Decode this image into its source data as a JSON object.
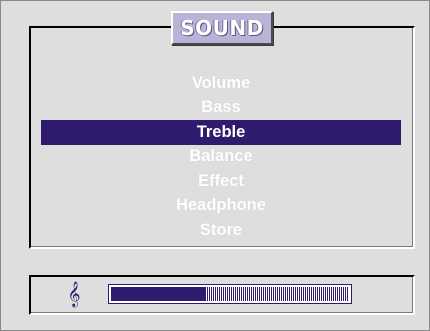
{
  "title": "SOUND",
  "menu": {
    "items": [
      {
        "label": "Volume",
        "selected": false
      },
      {
        "label": "Bass",
        "selected": false
      },
      {
        "label": "Treble",
        "selected": true
      },
      {
        "label": "Balance",
        "selected": false
      },
      {
        "label": "Effect",
        "selected": false
      },
      {
        "label": "Headphone",
        "selected": false
      },
      {
        "label": "Store",
        "selected": false
      }
    ]
  },
  "level": {
    "icon": "treble-clef-icon",
    "glyph": "𝄞",
    "value": 0.4
  },
  "colors": {
    "background": "#dedede",
    "title_box": "#b9b3d8",
    "highlight": "#2e1b6e",
    "text": "#ffffff"
  }
}
